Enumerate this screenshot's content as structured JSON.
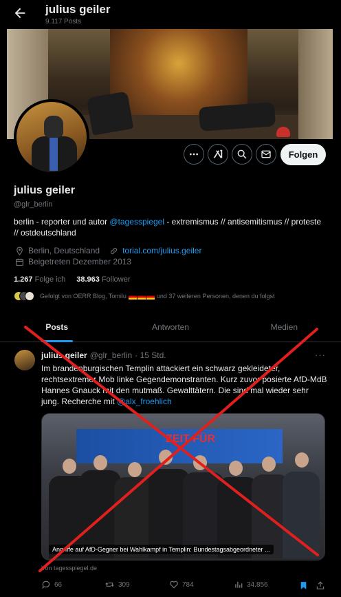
{
  "header": {
    "title": "julius geiler",
    "posts_count": "9.117 Posts"
  },
  "actions": {
    "follow_label": "Folgen"
  },
  "profile": {
    "name": "julius geiler",
    "handle": "@glr_berlin",
    "bio_part1": "berlin - reporter und autor ",
    "bio_link": "@tagesspiegel",
    "bio_part2": " - extremismus // antisemitismus // proteste // ostdeutschland",
    "location": "Berlin, Deutschland",
    "website": "torial.com/julius.geiler",
    "joined": "Beigetreten Dezember 2013",
    "following_count": "1.267",
    "following_label": "Folge ich",
    "followers_count": "38.963",
    "followers_label": "Follower",
    "followed_by_prefix": "Gefolgt von OERR Blog, Tomilu ",
    "followed_by_suffix": " und 37 weiteren Personen, denen du folgst"
  },
  "tabs": [
    "Posts",
    "Antworten",
    "Medien"
  ],
  "tweet": {
    "author": "julius geiler",
    "handle": "@glr_berlin",
    "time": "· 15 Std.",
    "more": "···",
    "text_main": "Im brandenburgischen Templin attackiert ein schwarz gekleideter, rechtsextremer Mob linke Gegendemonstranten. Kurz zuvor posierte AfD-MdB Hannes Gnauck mit den mutmaß. Gewalttätern. Die sind mal wieder sehr jung. Recherche mit ",
    "text_link": "@alx_froehlich",
    "media_banner_text": "ZEIT FÜR",
    "card_caption": "Angriffe auf AfD-Gegner bei Wahlkampf in Templin: Bundestagsabgeordneter ...",
    "card_source": "Von tagesspiegel.de",
    "replies": "66",
    "reposts": "309",
    "likes": "784",
    "views": "34.856"
  },
  "colors": {
    "accent": "#1d9bf0",
    "background": "#000000",
    "text": "#e7e9ea",
    "muted": "#71767b",
    "overlay_x": "#e0201e"
  },
  "icons": [
    "arrow-left-icon",
    "more-icon",
    "grok-icon",
    "search-icon",
    "mail-icon",
    "location-icon",
    "link-icon",
    "calendar-icon",
    "reply-icon",
    "repost-icon",
    "like-icon",
    "views-icon",
    "bookmark-icon",
    "share-icon"
  ]
}
